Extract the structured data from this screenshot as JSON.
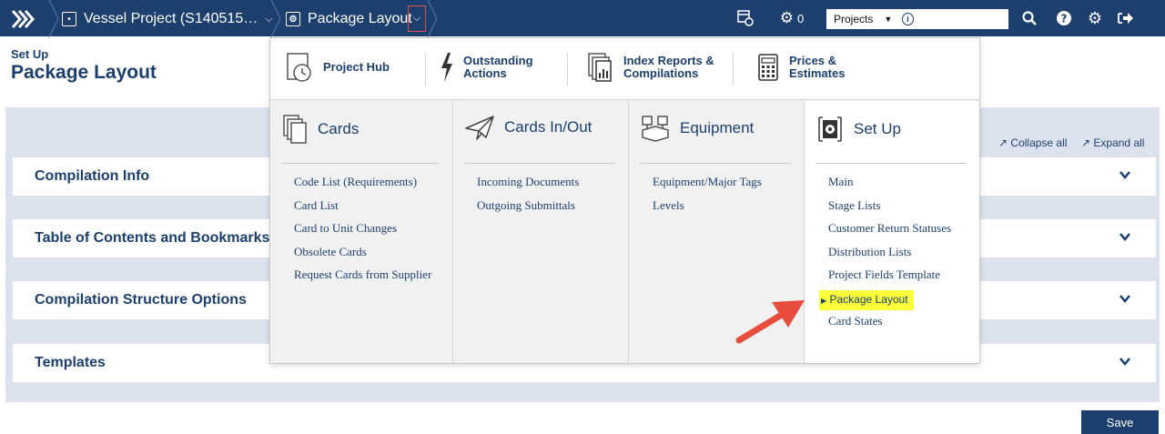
{
  "topbar": {
    "project_label": "Vessel Project (S140515…",
    "page_label": "Package Layout",
    "tasks_count": "0",
    "search": {
      "scope": "Projects",
      "placeholder": ""
    },
    "icons": [
      "menu-expand-icon",
      "project-icon",
      "package-icon",
      "schedule-icon",
      "tasks-gear-icon",
      "search-icon",
      "help-icon",
      "settings-icon",
      "logout-icon"
    ]
  },
  "page": {
    "subtitle": "Set Up",
    "title": "Package Layout",
    "collapse_all": "Collapse all",
    "expand_all": "Expand all",
    "sections": [
      "Compilation Info",
      "Table of Contents and Bookmarks Section",
      "Compilation Structure Options",
      "Templates"
    ],
    "save_label": "Save"
  },
  "menu": {
    "top_links": [
      {
        "label": "Project Hub",
        "icon": "project-hub-icon"
      },
      {
        "label": "Outstanding Actions",
        "icon": "lightning-icon"
      },
      {
        "label": "Index Reports & Compilations",
        "icon": "report-icon"
      },
      {
        "label": "Prices & Estimates",
        "icon": "calculator-icon"
      }
    ],
    "columns": [
      {
        "heading": "Cards",
        "icon": "cards-icon",
        "items": [
          "Code List (Requirements)",
          "Card List",
          "Card to Unit Changes",
          "Obsolete Cards",
          "Request Cards from Supplier"
        ]
      },
      {
        "heading": "Cards In/Out",
        "icon": "paper-plane-icon",
        "items": [
          "Incoming Documents",
          "Outgoing Submittals"
        ]
      },
      {
        "heading": "Equipment",
        "icon": "equipment-icon",
        "items": [
          "Equipment/Major Tags",
          "Levels"
        ]
      },
      {
        "heading": "Set Up",
        "icon": "setup-gear-icon",
        "items": [
          "Main",
          "Stage Lists",
          "Customer Return Statuses",
          "Distribution Lists",
          "Project Fields Template",
          "Package Layout",
          "Card States"
        ],
        "active_item": "Package Layout"
      }
    ]
  },
  "colors": {
    "navy": "#1c3f6e",
    "highlight": "#fbff3a",
    "panel": "#dde3ee",
    "arrow": "#e74c3c",
    "toggle_border": "#d9534f"
  }
}
